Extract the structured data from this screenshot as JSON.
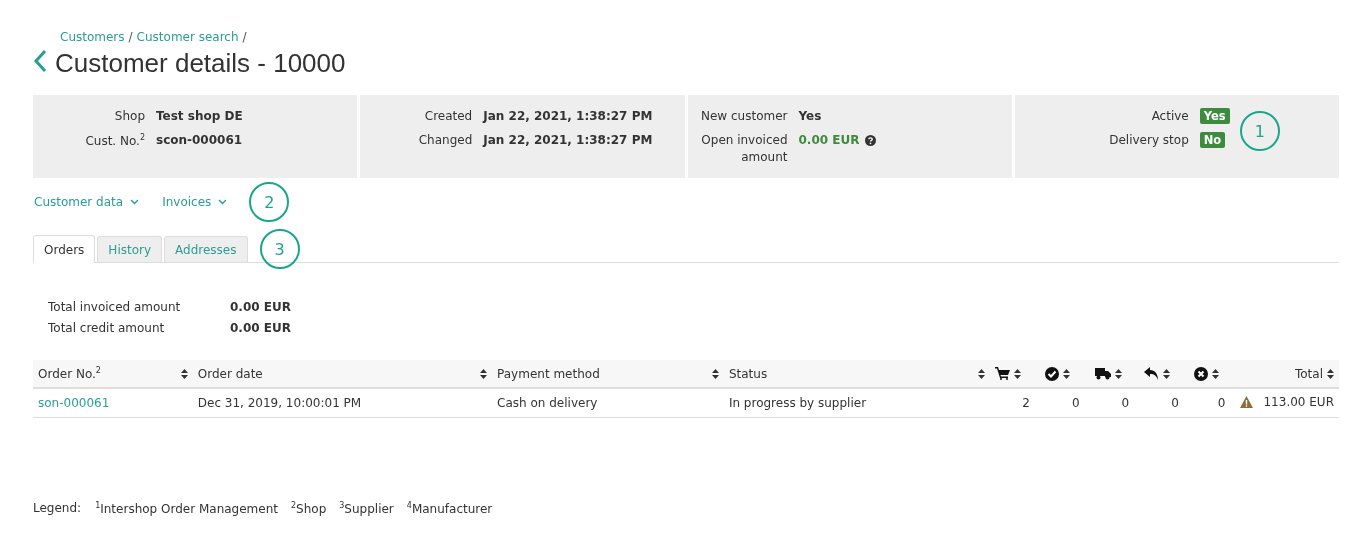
{
  "breadcrumb": [
    {
      "label": "Customers",
      "separator": "/"
    },
    {
      "label": "Customer search",
      "separator": "/"
    }
  ],
  "title": "Customer details - 10000",
  "info_panels": [
    {
      "fields": [
        {
          "label": "Shop",
          "value": "Test shop DE",
          "kind": "text"
        },
        {
          "label": "Cust. No.$^{2}$",
          "value": "scon-000061",
          "kind": "text"
        }
      ]
    },
    {
      "fields": [
        {
          "label": "Created",
          "value": "Jan 22, 2021, 1:38:27 PM",
          "kind": "text"
        },
        {
          "label": "Changed",
          "value": "Jan 22, 2021, 1:38:27 PM",
          "kind": "text"
        }
      ]
    },
    {
      "fields": [
        {
          "label": "New customer",
          "value": "Yes",
          "kind": "text"
        },
        {
          "label": "Open invoiced amount",
          "value": "0.00 EUR",
          "kind": "amount"
        }
      ]
    },
    {
      "fields": [
        {
          "label": "Active",
          "value": "Yes",
          "kind": "badge"
        },
        {
          "label": "Delivery stop",
          "value": "No",
          "kind": "badge"
        }
      ],
      "callout": "1"
    }
  ],
  "menus": [
    {
      "label": "Customer data"
    },
    {
      "label": "Invoices"
    }
  ],
  "menus_callout": "2",
  "tabs": [
    {
      "label": "Orders",
      "selected": true
    },
    {
      "label": "History",
      "selected": false
    },
    {
      "label": "Addresses",
      "selected": false
    }
  ],
  "tabs_callout": "3",
  "totals": [
    {
      "label": "Total invoiced amount",
      "value": "0.00 EUR"
    },
    {
      "label": "Total credit amount",
      "value": "0.00 EUR"
    }
  ],
  "table": {
    "columns": [
      {
        "kind": "text",
        "label": "Order No.$^{2}$"
      },
      {
        "kind": "text",
        "label": "Order date"
      },
      {
        "kind": "text",
        "label": "Payment method"
      },
      {
        "kind": "text",
        "label": "Status"
      },
      {
        "kind": "icon"
      },
      {
        "kind": "icon"
      },
      {
        "kind": "icon"
      },
      {
        "kind": "icon"
      },
      {
        "kind": "icon"
      },
      {
        "kind": "total",
        "label": "Total"
      }
    ],
    "rows": [
      {
        "order_no": "son-000061",
        "date": "Dec 31, 2019, 10:00:01 PM",
        "payment": "Cash on delivery",
        "status": "In progress by supplier",
        "counts": [
          "2",
          "0",
          "0",
          "0",
          "0"
        ],
        "warning": true,
        "total": "113.00 EUR"
      }
    ]
  },
  "legend": {
    "label": "Legend:",
    "items": [
      "$^{1}$Intershop Order Management",
      "$^{2}$Shop",
      "$^{3}$Supplier",
      "$^{4}$Manufacturer"
    ]
  }
}
